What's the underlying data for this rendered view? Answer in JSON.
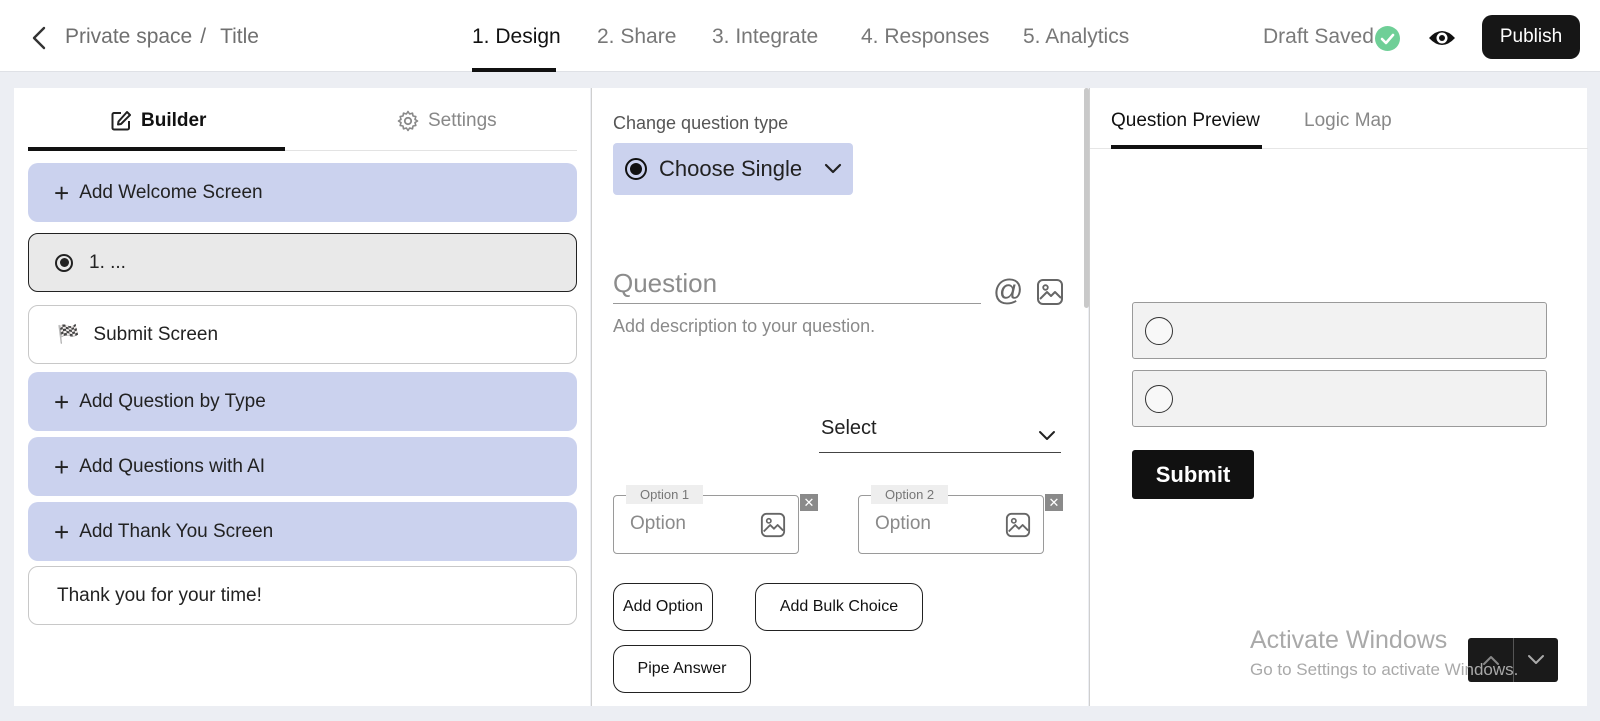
{
  "header": {
    "breadcrumb": {
      "space": "Private space",
      "separator": "/",
      "title": "Title"
    },
    "steps": [
      {
        "label": "1. Design",
        "active": true
      },
      {
        "label": "2. Share",
        "active": false
      },
      {
        "label": "3. Integrate",
        "active": false
      },
      {
        "label": "4. Responses",
        "active": false
      },
      {
        "label": "5. Analytics",
        "active": false
      }
    ],
    "draft_status": "Draft Saved",
    "publish_label": "Publish"
  },
  "left": {
    "tabs": {
      "builder": "Builder",
      "settings": "Settings"
    },
    "items": {
      "welcome": "Add Welcome Screen",
      "question1": "1. ...",
      "submit_screen": "Submit Screen",
      "add_by_type": "Add Question by Type",
      "add_ai": "Add Questions with AI",
      "add_thanks": "Add Thank You Screen",
      "thanks_text": "Thank you for your time!"
    }
  },
  "editor": {
    "change_type_label": "Change question type",
    "question_type": "Choose Single",
    "question_placeholder": "Question",
    "description_placeholder": "Add description to your question.",
    "select_label": "Select",
    "options": [
      {
        "tag": "Option 1",
        "placeholder": "Option"
      },
      {
        "tag": "Option 2",
        "placeholder": "Option"
      }
    ],
    "buttons": {
      "add_option": "Add Option",
      "add_bulk": "Add Bulk Choice",
      "pipe_answer": "Pipe Answer"
    }
  },
  "preview": {
    "tabs": {
      "preview": "Question Preview",
      "logic": "Logic Map"
    },
    "submit_label": "Submit"
  },
  "watermark": {
    "line1": "Activate Windows",
    "line2": "Go to Settings to activate Windows."
  },
  "colors": {
    "accent_bg": "#cbd2ee",
    "success": "#6fcf97",
    "dark": "#161616"
  }
}
